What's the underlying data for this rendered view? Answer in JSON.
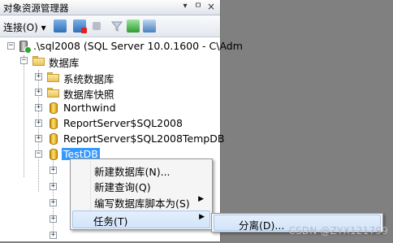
{
  "window": {
    "title": "对象资源管理器",
    "pin_glyph": "ㅁ",
    "close_glyph": "×",
    "dropdown_glyph": "▾"
  },
  "toolbar": {
    "connect_label": "连接(O)",
    "connect_arrow": "▾"
  },
  "tree": {
    "expand_minus": "−",
    "expand_plus": "+",
    "server": ".\\sql2008 (SQL Server 10.0.1600 - C\\Adm",
    "databases": "数据库",
    "items": [
      {
        "label": "系统数据库",
        "icon": "folder-icon"
      },
      {
        "label": "数据库快照",
        "icon": "folder-icon"
      },
      {
        "label": "Northwind",
        "icon": "database-icon"
      },
      {
        "label": "ReportServer$SQL2008",
        "icon": "database-icon"
      },
      {
        "label": "ReportServer$SQL2008TempDB",
        "icon": "database-icon"
      },
      {
        "label": "TestDB",
        "icon": "database-icon"
      }
    ]
  },
  "context_menu": {
    "items": [
      {
        "label": "新建数据库(N)...",
        "arrow": ""
      },
      {
        "label": "新建查询(Q)",
        "arrow": ""
      },
      {
        "label": "编写数据库脚本为(S)",
        "arrow": "▶"
      },
      {
        "label": "任务(T)",
        "arrow": "▶"
      }
    ]
  },
  "submenu": {
    "items": [
      {
        "label": "分离(D)..."
      }
    ]
  },
  "watermark": "CSDN @ZYX121799",
  "colors": {
    "selection": "#3399ff",
    "background": "#808080"
  }
}
